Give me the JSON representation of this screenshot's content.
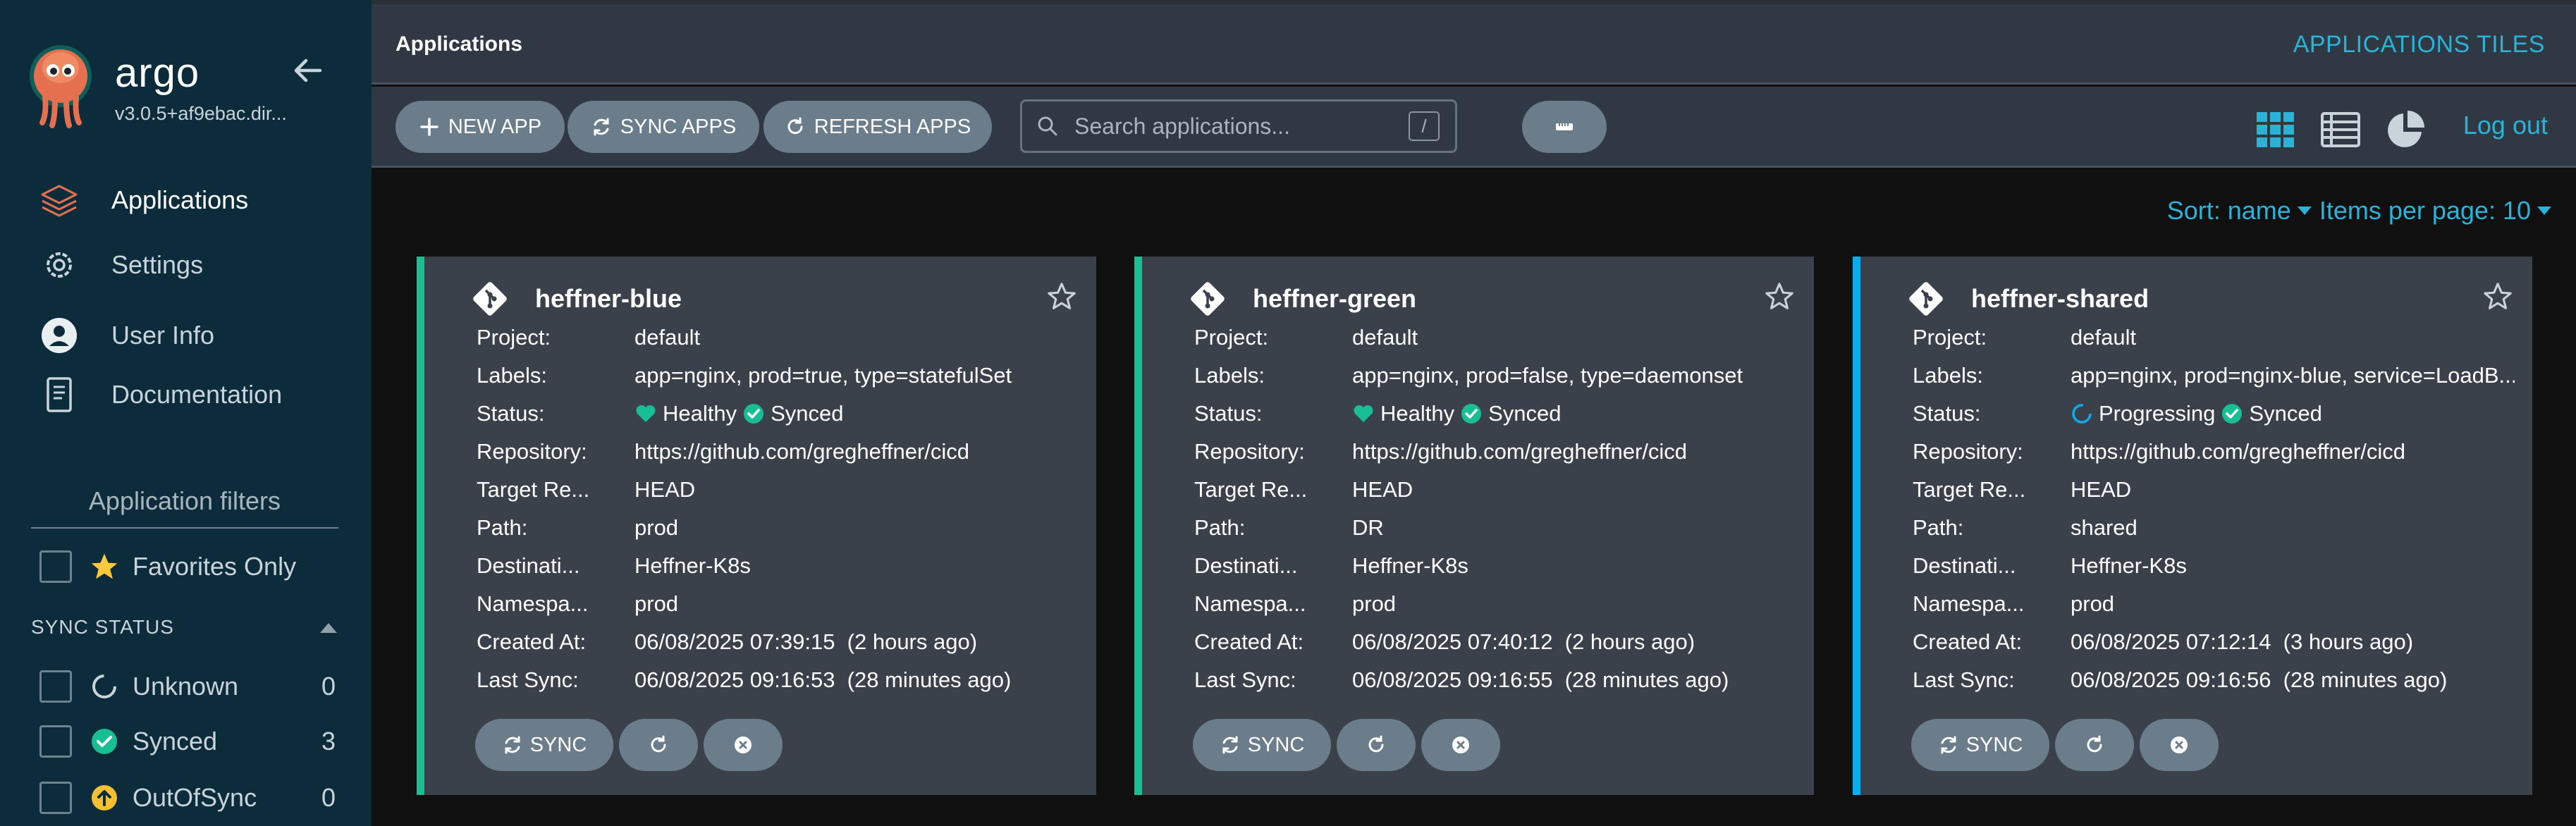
{
  "sidebar": {
    "brand": "argo",
    "version": "v3.0.5+af9ebac.dir...",
    "nav": [
      {
        "label": "Applications",
        "icon": "stack-icon",
        "active": true
      },
      {
        "label": "Settings",
        "icon": "gear-icon",
        "active": false
      },
      {
        "label": "User Info",
        "icon": "user-icon",
        "active": false
      },
      {
        "label": "Documentation",
        "icon": "book-icon",
        "active": false
      }
    ],
    "filters_title": "Application filters",
    "favorites_label": "Favorites Only",
    "sync_status_heading": "SYNC STATUS",
    "sync_filters": [
      {
        "label": "Unknown",
        "count": "0",
        "icon": "circle-notch-icon"
      },
      {
        "label": "Synced",
        "count": "3",
        "icon": "check-circle-icon"
      },
      {
        "label": "OutOfSync",
        "count": "0",
        "icon": "arrow-up-circle-icon"
      }
    ]
  },
  "header": {
    "title": "Applications",
    "view_title": "APPLICATIONS TILES"
  },
  "toolbar": {
    "new_app": "NEW APP",
    "sync_apps": "SYNC APPS",
    "refresh_apps": "REFRESH APPS",
    "search_placeholder": "Search applications...",
    "search_shortcut": "/",
    "logout": "Log out"
  },
  "sort": {
    "sort_label": "Sort: name",
    "items_label": "Items per page: 10"
  },
  "labels": {
    "project": "Project:",
    "labels": "Labels:",
    "status": "Status:",
    "repository": "Repository:",
    "target": "Target Re...",
    "path": "Path:",
    "destination": "Destinati...",
    "namespace": "Namespa...",
    "created": "Created At:",
    "last_sync": "Last Sync:"
  },
  "apps": [
    {
      "name": "heffner-blue",
      "project": "default",
      "labels": "app=nginx, prod=true, type=statefulSet",
      "health": "Healthy",
      "sync": "Synced",
      "repository": "https://github.com/gregheffner/cicd",
      "target": "HEAD",
      "path": "prod",
      "destination": "Heffner-K8s",
      "namespace": "prod",
      "created": "06/08/2025 07:39:15  (2 hours ago)",
      "last_sync": "06/08/2025 09:16:53  (28 minutes ago)",
      "sync_button": "SYNC",
      "accent": "#18be94"
    },
    {
      "name": "heffner-green",
      "project": "default",
      "labels": "app=nginx, prod=false, type=daemonset",
      "health": "Healthy",
      "sync": "Synced",
      "repository": "https://github.com/gregheffner/cicd",
      "target": "HEAD",
      "path": "DR",
      "destination": "Heffner-K8s",
      "namespace": "prod",
      "created": "06/08/2025 07:40:12  (2 hours ago)",
      "last_sync": "06/08/2025 09:16:55  (28 minutes ago)",
      "sync_button": "SYNC",
      "accent": "#18be94"
    },
    {
      "name": "heffner-shared",
      "project": "default",
      "labels": "app=nginx, prod=nginx-blue, service=LoadB...",
      "health": "Progressing",
      "sync": "Synced",
      "repository": "https://github.com/gregheffner/cicd",
      "target": "HEAD",
      "path": "shared",
      "destination": "Heffner-K8s",
      "namespace": "prod",
      "created": "06/08/2025 07:12:14  (3 hours ago)",
      "last_sync": "06/08/2025 09:16:56  (28 minutes ago)",
      "sync_button": "SYNC",
      "accent": "#0dadea"
    }
  ],
  "colors": {
    "sidebar_bg": "#0d2c3b",
    "header_bg": "#303843",
    "accent_link": "#2bb3d7",
    "healthy": "#18be94",
    "progressing": "#0dadea"
  }
}
